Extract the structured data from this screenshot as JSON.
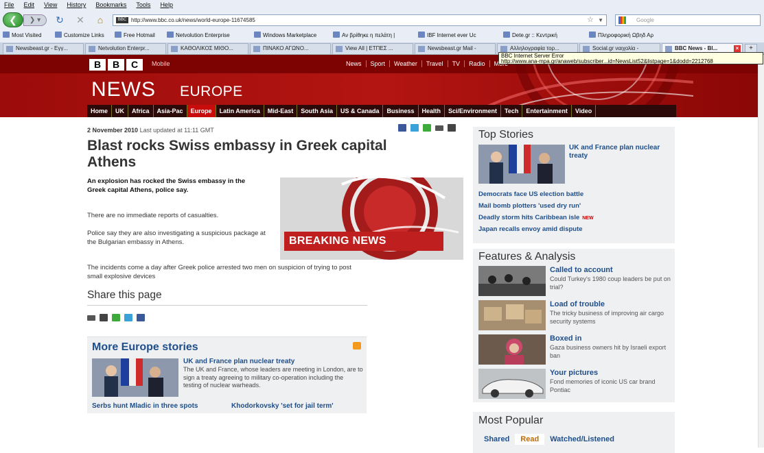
{
  "browser": {
    "menu": [
      "File",
      "Edit",
      "View",
      "History",
      "Bookmarks",
      "Tools",
      "Help"
    ],
    "url": "http://www.bbc.co.uk/news/world-europe-11674585",
    "url_badge": "BBC",
    "search_placeholder": "Google",
    "bookmarks": [
      "Most Visited",
      "Customize Links",
      "Free Hotmail",
      "Netvolution Enterprise",
      "Windows Marketplace",
      "Αν βρίθηκε η πελάτη |",
      "IBF Internet ever Uc",
      "Dete.gr :: Κεντρική",
      "Πληροφορική Ωβηδ Αρ"
    ],
    "tabs": [
      "Newsbeast.gr - Εγγ...",
      "Netvolution Enterpr...",
      "ΚΑΘΟΛΙΚΟΣ ΜΙΘΟ...",
      "ΠΙΝΑΚΟ ΑΓΩΝΟ...",
      "View All | ΕΤΠΕΣ ...",
      "Newsbeast.gr Mail -",
      "Αλληλογραφία τορ...",
      "Social.gr ναιχολία -",
      "BBC News - Bl..."
    ],
    "tooltip_line1": "BBC Internet Server Error",
    "tooltip_line2": "http://www.ana-mpa.gr/anaweb/subscriber...id=NewsList52&listpage=1&dodd=2212768",
    "newtab": "+"
  },
  "masthead": {
    "logo": [
      "B",
      "B",
      "C"
    ],
    "mobile": "Mobile",
    "top_links": [
      "News",
      "Sport",
      "Weather",
      "Travel",
      "TV",
      "Radio",
      "More"
    ],
    "title": "NEWS",
    "subtitle": "EUROPE",
    "sections": [
      "Home",
      "UK",
      "Africa",
      "Asia-Pac",
      "Europe",
      "Latin America",
      "Mid-East",
      "South Asia",
      "US & Canada",
      "Business",
      "Health",
      "Sci/Environment",
      "Tech",
      "Entertainment",
      "Video"
    ],
    "selected_section": "Europe"
  },
  "article": {
    "date": "2 November 2010",
    "updated": "Last updated at 11:11 GMT",
    "headline": "Blast rocks Swiss embassy in Greek capital Athens",
    "intro": "An explosion has rocked the Swiss embassy in the Greek capital Athens, police say.",
    "p1": "There are no immediate reports of casualties.",
    "p2": "Police say they are also investigating a suspicious package at the Bulgarian embassy in Athens.",
    "p3": "The incidents come a day after Greek police arrested two men on suspicion of trying to post small explosive devices",
    "breaking_label": "BREAKING NEWS"
  },
  "share": {
    "title": "Share this page"
  },
  "more_europe": {
    "title": "More Europe stories",
    "headline": "UK and France plan nuclear treaty",
    "desc": "The UK and France, whose leaders are meeting in London, are to sign a treaty agreeing to military co-operation including the testing of nuclear warheads.",
    "link1": "Serbs hunt Mladic in three spots",
    "link2": "Khodorkovsky 'set for jail term'"
  },
  "top_stories": {
    "title": "Top Stories",
    "lead": "UK and France plan nuclear treaty",
    "links": [
      "Democrats face US election battle",
      "Mail bomb plotters 'used dry run'",
      "Deadly storm hits Caribbean isle",
      "Japan recalls envoy amid dispute"
    ],
    "new_badge": "NEW"
  },
  "features": {
    "title": "Features & Analysis",
    "items": [
      {
        "h": "Called to account",
        "d": "Could Turkey's 1980 coup leaders be put on trial?"
      },
      {
        "h": "Load of trouble",
        "d": "The tricky business of improving air cargo security systems"
      },
      {
        "h": "Boxed in",
        "d": "Gaza business owners hit by Israeli export ban"
      },
      {
        "h": "Your pictures",
        "d": "Fond memories of iconic US car brand Pontiac"
      }
    ]
  },
  "most_popular": {
    "title": "Most Popular",
    "tabs": [
      "Shared",
      "Read",
      "Watched/Listened"
    ],
    "active_tab": "Read"
  },
  "colors": {
    "bbc_red": "#b31512",
    "link_blue": "#1f4e8a"
  }
}
